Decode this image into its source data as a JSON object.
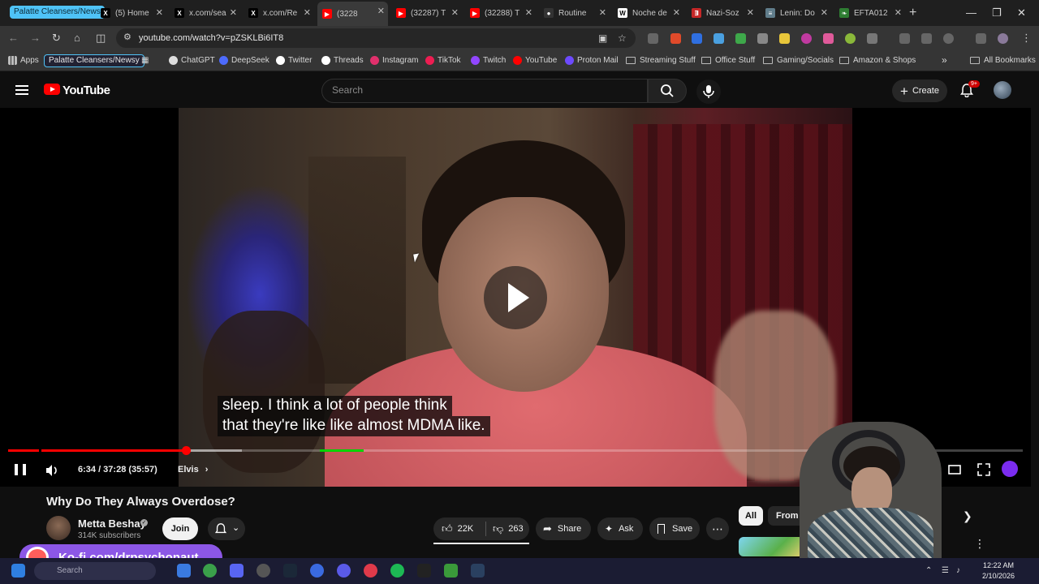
{
  "browser": {
    "tab_group_label": "Palatte Cleansers/News",
    "tabs": [
      {
        "title": "(5) Home",
        "favicon": "x-logo-icon"
      },
      {
        "title": "x.com/search",
        "favicon": "x-logo-icon"
      },
      {
        "title": "x.com/Re",
        "favicon": "x-logo-icon"
      },
      {
        "title": "(3228",
        "favicon": "youtube-icon",
        "active": true
      },
      {
        "title": "(32287) T",
        "favicon": "youtube-icon"
      },
      {
        "title": "(32288) T",
        "favicon": "youtube-icon"
      },
      {
        "title": "Routine",
        "favicon": "github-icon"
      },
      {
        "title": "Noche de",
        "favicon": "wikipedia-icon"
      },
      {
        "title": "Nazi-Soz",
        "favicon": "pdf-icon"
      },
      {
        "title": "Lenin: Do",
        "favicon": "doc-icon"
      },
      {
        "title": "EFTA012",
        "favicon": "leaf-icon"
      }
    ],
    "url": "youtube.com/watch?v=pZSKLBi6IT8",
    "bookmarks": {
      "apps": "Apps",
      "palatte": "Palatte Cleansers/Newsy",
      "items": [
        {
          "label": "ChatGPT",
          "icon": "chatgpt-icon"
        },
        {
          "label": "DeepSeek",
          "icon": "deepseek-icon"
        },
        {
          "label": "Twitter",
          "icon": "x-logo-icon"
        },
        {
          "label": "Threads",
          "icon": "threads-icon"
        },
        {
          "label": "Instagram",
          "icon": "instagram-icon"
        },
        {
          "label": "TikTok",
          "icon": "tiktok-icon"
        },
        {
          "label": "Twitch",
          "icon": "twitch-icon"
        },
        {
          "label": "YouTube",
          "icon": "youtube-icon"
        },
        {
          "label": "Proton Mail",
          "icon": "proton-icon"
        }
      ],
      "folders": [
        "Streaming Stuff",
        "Office Stuff",
        "Gaming/Socials",
        "Amazon & Shops"
      ],
      "all_bookmarks": "All Bookmarks"
    }
  },
  "youtube": {
    "logo_text": "YouTube",
    "search_placeholder": "Search",
    "create_label": "Create",
    "notification_count": "9+"
  },
  "player": {
    "captions": [
      "sleep. I think a lot of people think",
      "that they're like like almost MDMA like."
    ],
    "time_display": "6:34 / 37:28 (35:57)",
    "chapter": "Elvis",
    "progress_fraction": 0.175,
    "buffered_fraction": 0.23,
    "chapter_marks": [
      0.03
    ],
    "sponsor_segment": [
      0.307,
      0.35
    ],
    "colors": {
      "played": "#ff0000",
      "sponsor": "#00d400"
    }
  },
  "video": {
    "title": "Why Do They Always Overdose?",
    "channel_name": "Metta Beshay",
    "subscribers": "314K subscribers",
    "join_label": "Join",
    "likes": "22K",
    "dislikes": "263",
    "share_label": "Share",
    "ask_label": "Ask",
    "save_label": "Save"
  },
  "recommendations": {
    "chips": [
      "All",
      "From Me"
    ]
  },
  "overlay": {
    "kofi_text": "Ko-fi.com/drpsychonaut"
  },
  "taskbar": {
    "search_placeholder": "Search",
    "time": "12:22 AM",
    "date": "2/10/2026"
  }
}
